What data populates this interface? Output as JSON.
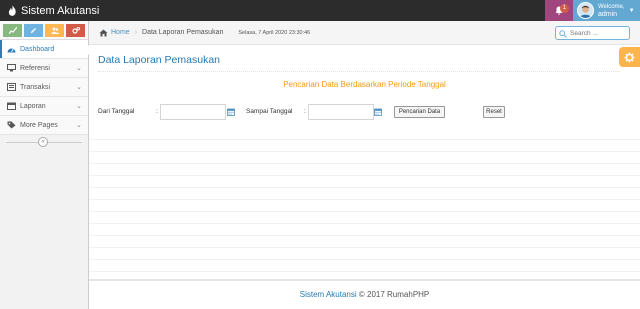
{
  "app": {
    "title": "Sistem Akutansi"
  },
  "navbar": {
    "notification_count": "1",
    "welcome_label": "Welcome,",
    "username": "admin"
  },
  "sidebar": {
    "shortcuts": [
      "chart-icon",
      "pencil-icon",
      "users-icon",
      "cogs-icon"
    ],
    "items": [
      {
        "label": "Dashboard",
        "icon": "dashboard-icon",
        "active": true
      },
      {
        "label": "Referensi",
        "icon": "desktop-icon"
      },
      {
        "label": "Transaksi",
        "icon": "list-icon"
      },
      {
        "label": "Laporan",
        "icon": "calendar-icon"
      },
      {
        "label": "More Pages",
        "icon": "tag-icon"
      }
    ]
  },
  "breadcrumbs": {
    "home": "Home",
    "current": "Data Laporan Pemasukan",
    "datetime": "Selasa, 7 April 2020 23:30:46"
  },
  "search": {
    "placeholder": "Search ..."
  },
  "page": {
    "title": "Data Laporan Pemasukan",
    "search_heading": "Pencarian Data Berdasarkan Periode Tanggal"
  },
  "form": {
    "from_label": "Dari Tanggal",
    "to_label": "Sampai Tanggal",
    "colon": ":",
    "from_value": "",
    "to_value": "",
    "search_button": "Pencarian Data",
    "reset_button": "Reset"
  },
  "footer": {
    "brand": "Sistem Akutansi",
    "text": "© 2017 RumahPHP"
  },
  "colors": {
    "navbar": "#2c2c2c",
    "accent_blue": "#438eb9",
    "title_blue": "#2679b5",
    "heading_orange": "#f39c12",
    "notification_purple": "#a0457e",
    "settings_orange": "#ffb44b"
  }
}
